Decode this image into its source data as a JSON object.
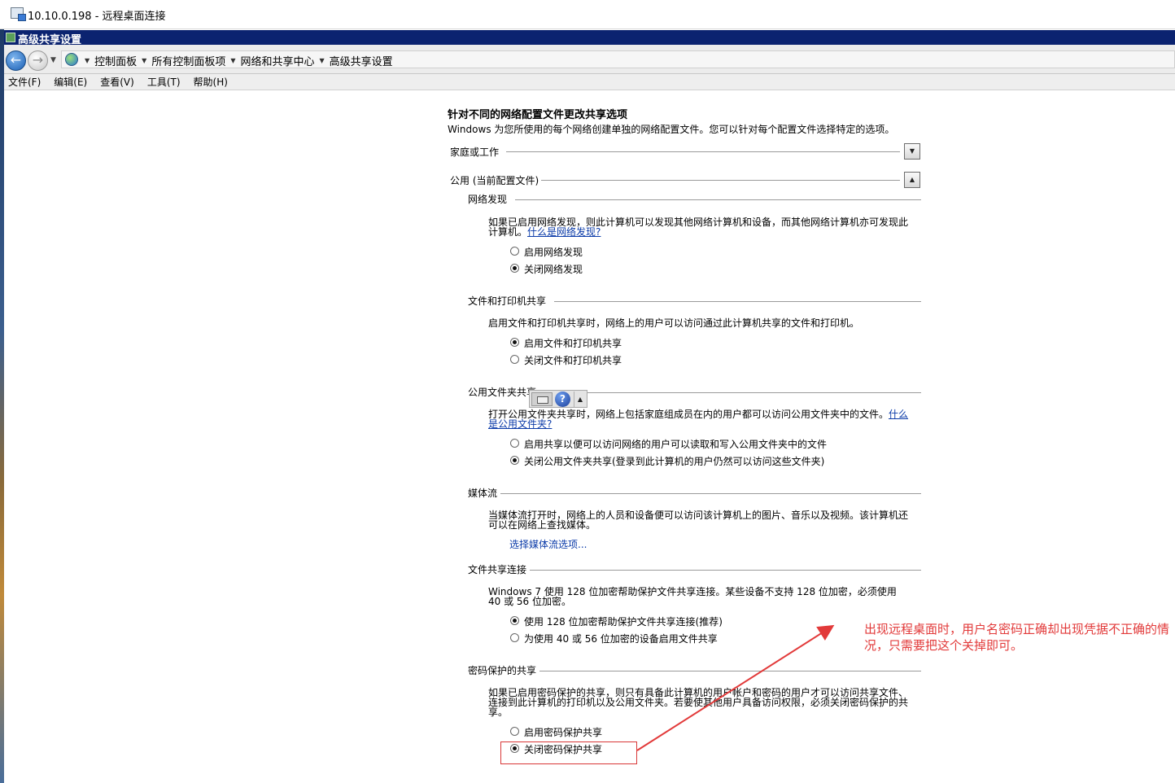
{
  "rdp": {
    "title": "10.10.0.198 - 远程桌面连接"
  },
  "window": {
    "title": "高级共享设置"
  },
  "breadcrumb": [
    "控制面板",
    "所有控制面板项",
    "网络和共享中心",
    "高级共享设置"
  ],
  "menu": [
    "文件(F)",
    "编辑(E)",
    "查看(V)",
    "工具(T)",
    "帮助(H)"
  ],
  "page": {
    "heading": "针对不同的网络配置文件更改共享选项",
    "subheading": "Windows 为您所使用的每个网络创建单独的网络配置文件。您可以针对每个配置文件选择特定的选项。",
    "profile_home": "家庭或工作",
    "profile_public": "公用 (当前配置文件)"
  },
  "sections": {
    "discovery": {
      "label": "网络发现",
      "desc": "如果已启用网络发现，则此计算机可以发现其他网络计算机和设备，而其他网络计算机亦可发现此计算机。",
      "link": "什么是网络发现?",
      "opt_on": "启用网络发现",
      "opt_off": "关闭网络发现"
    },
    "file_print": {
      "label": "文件和打印机共享",
      "desc": "启用文件和打印机共享时，网络上的用户可以访问通过此计算机共享的文件和打印机。",
      "opt_on": "启用文件和打印机共享",
      "opt_off": "关闭文件和打印机共享"
    },
    "public_folder": {
      "label": "公用文件夹共享",
      "desc": "打开公用文件夹共享时，网络上包括家庭组成员在内的用户都可以访问公用文件夹中的文件。",
      "link": "什么是公用文件夹?",
      "opt_on": "启用共享以便可以访问网络的用户可以读取和写入公用文件夹中的文件",
      "opt_off": "关闭公用文件夹共享(登录到此计算机的用户仍然可以访问这些文件夹)"
    },
    "media": {
      "label": "媒体流",
      "desc": "当媒体流打开时，网络上的人员和设备便可以访问该计算机上的图片、音乐以及视频。该计算机还可以在网络上查找媒体。",
      "link": "选择媒体流选项..."
    },
    "file_sharing_conn": {
      "label": "文件共享连接",
      "desc": "Windows 7 使用 128 位加密帮助保护文件共享连接。某些设备不支持 128 位加密，必须使用 40 或 56 位加密。",
      "opt_128": "使用 128 位加密帮助保护文件共享连接(推荐)",
      "opt_40_56": "为使用 40 或 56 位加密的设备启用文件共享"
    },
    "password": {
      "label": "密码保护的共享",
      "desc": "如果已启用密码保护的共享，则只有具备此计算机的用户帐户和密码的用户才可以访问共享文件、连接到此计算机的打印机以及公用文件夹。若要使其他用户具备访问权限，必须关闭密码保护的共享。",
      "opt_on": "启用密码保护共享",
      "opt_off": "关闭密码保护共享"
    }
  },
  "annotation": {
    "text": "出现远程桌面时，用户名密码正确却出现凭据不正确的情况，只需要把这个关掉即可。",
    "color": "#e23a3a"
  },
  "icons": {
    "back": "back-arrow-icon",
    "forward": "forward-arrow-icon",
    "help": "?"
  },
  "colors": {
    "title_bar": "#0b2370",
    "link": "#0a3aa8"
  }
}
